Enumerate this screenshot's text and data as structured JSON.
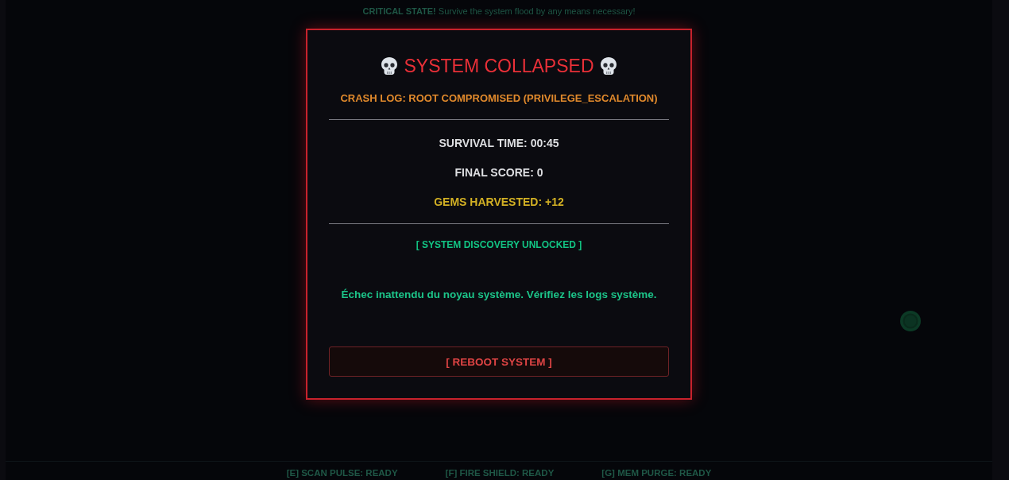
{
  "hud": {
    "alert": "**CRITICAL STATE!** Survive the system flood by any means necessary!"
  },
  "dialog": {
    "title": "SYSTEM COLLAPSED",
    "crash_log": "CRASH LOG: ROOT COMPROMISED (PRIVILEGE_ESCALATION)",
    "stats": [
      {
        "kind": "plain",
        "text": "SURVIVAL TIME: 00:45"
      },
      {
        "kind": "plain",
        "text": "FINAL SCORE: 0"
      },
      {
        "kind": "gems",
        "text": "GEMS HARVESTED: +12"
      }
    ],
    "unlock": "[ SYSTEM DISCOVERY UNLOCKED ]",
    "message": "Échec inattendu du noyau système. Vérifiez les logs système.",
    "button": "[ REBOOT SYSTEM ]"
  },
  "abilities": [
    {
      "text": "[E] SCAN PULSE: READY"
    },
    {
      "text": "[F] FIRE SHIELD: READY"
    },
    {
      "text": "[G] MEM PURGE: READY"
    }
  ]
}
